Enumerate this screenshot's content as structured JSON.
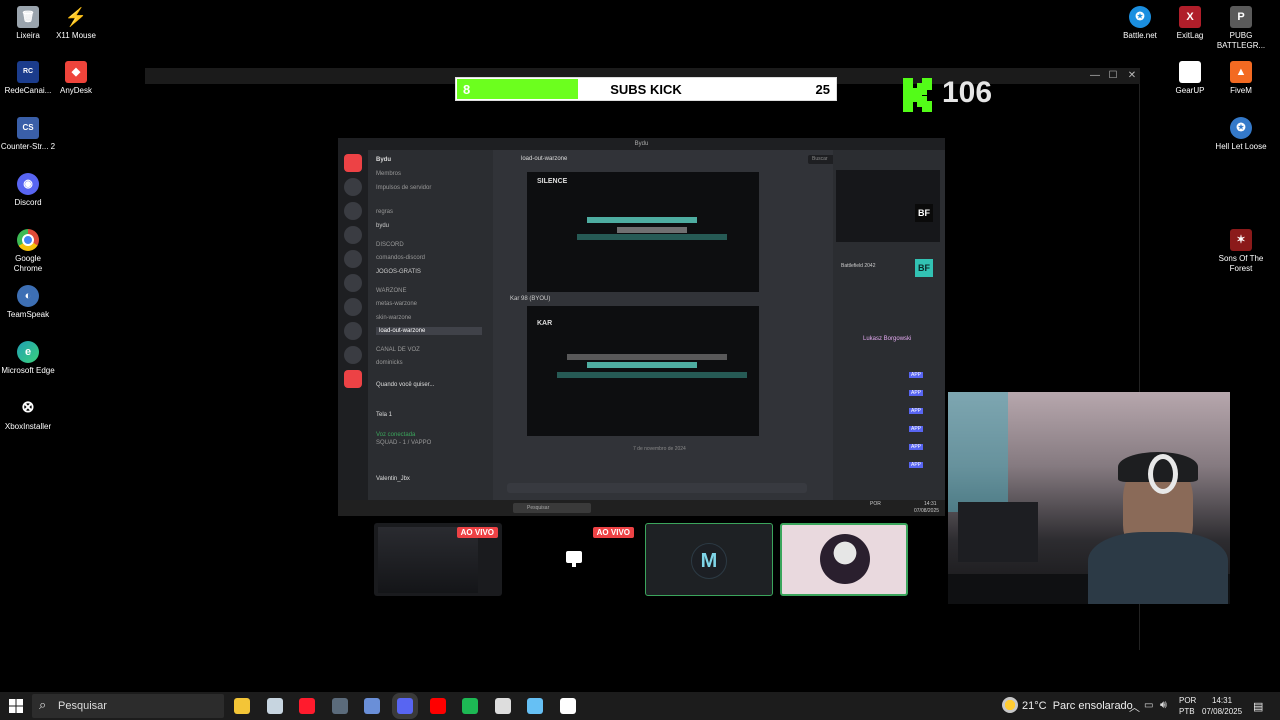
{
  "desktop_left": [
    {
      "label": "Lixeira",
      "icon": "recycle-bin-icon",
      "color": "#9aa4ad",
      "glyph": "🗑"
    },
    {
      "label": "X11 Mouse",
      "icon": "x11-mouse-icon",
      "color": "#f5c400",
      "glyph": "⚡"
    },
    {
      "label": "RedeCanai...",
      "icon": "redecanais-icon",
      "color": "#1b3c8c",
      "glyph": "R"
    },
    {
      "label": "AnyDesk",
      "icon": "anydesk-icon",
      "color": "#ef443b",
      "glyph": "◆"
    },
    {
      "label": "Counter-Str... 2",
      "icon": "counter-strike-icon",
      "color": "#3a5fa8",
      "glyph": "CS"
    },
    {
      "label": "Discord",
      "icon": "discord-icon",
      "color": "#5865f2",
      "glyph": "◉"
    },
    {
      "label": "Google Chrome",
      "icon": "chrome-icon",
      "color": "#dd4b39",
      "glyph": "◎"
    },
    {
      "label": "TeamSpeak",
      "icon": "teamspeak-icon",
      "color": "#3d6fb4",
      "glyph": "◐"
    },
    {
      "label": "Microsoft Edge",
      "icon": "edge-icon",
      "color": "#1fa0b5",
      "glyph": "e"
    },
    {
      "label": "XboxInstaller",
      "icon": "xbox-icon",
      "color": "#000000",
      "glyph": "⊗"
    }
  ],
  "desktop_right": [
    {
      "label": "Battle.net",
      "icon": "battlenet-icon",
      "color": "#1b8fe0",
      "glyph": "✪"
    },
    {
      "label": "ExitLag",
      "icon": "exitlag-icon",
      "color": "#b01e2a",
      "glyph": "X"
    },
    {
      "label": "PUBG BATTLEGR...",
      "icon": "pubg-icon",
      "color": "#5a5a5a",
      "glyph": "P"
    },
    {
      "label": "GearUP",
      "icon": "gearup-icon",
      "color": "#ffffff",
      "glyph": "▭"
    },
    {
      "label": "FiveM",
      "icon": "fivem-icon",
      "color": "#f36a22",
      "glyph": "▲"
    },
    {
      "label": "Hell Let Loose",
      "icon": "hell-let-loose-icon",
      "color": "#3479c9",
      "glyph": "✪"
    },
    {
      "label": "Sons Of The Forest",
      "icon": "sons-of-the-forest-icon",
      "color": "#8b1a1a",
      "glyph": "✶"
    }
  ],
  "subs_bar": {
    "current": "8",
    "title": "SUBS KICK",
    "goal": "25",
    "progress": 0.32,
    "fill_color": "#6cff1e"
  },
  "kick": {
    "count": "106",
    "brand_color": "#53fc18"
  },
  "discord": {
    "window_title": "Bydu",
    "server_name": "Bydu",
    "channel_header": "load-out-warzone",
    "search_placeholder": "Buscar",
    "channels": [
      "Membros",
      "Impulsos de servidor",
      "regras",
      "bydu",
      "DISCORD",
      "comandos-discord",
      "JOGOS-GRATIS",
      "WARZONE",
      "metas-warzone",
      "skin-warzone",
      "load-out-warzone",
      "CANAL DE VOZ",
      "dominicks"
    ],
    "msg_author": "Kar 98 (BYOU)",
    "img1_label": "SILENCE",
    "img2_label": "KAR",
    "date_divider": "7 de novembro de 2024",
    "bottom_user": "Valentin_Jbx",
    "voice_status": "Voz conectada",
    "voice_channel": "SQUAD - 1 / VAPPO",
    "stream_label": "Quando você quiser...",
    "tela": "Tela 1",
    "member_header": "Battlefield 2042",
    "member_name": "Lukasz Borgowski",
    "app_badge": "APP",
    "taskbar_search": "Pesquisar",
    "taskbar_lang": "POR",
    "taskbar_time": "14:31",
    "taskbar_date": "07/08/2025",
    "server_badges": [
      "BF",
      "BF"
    ]
  },
  "tiles": [
    {
      "name": "stream-tile-1",
      "live": "AO VIVO"
    },
    {
      "name": "stream-tile-2",
      "live": "AO VIVO"
    },
    {
      "name": "avatar-tile-m"
    },
    {
      "name": "avatar-tile-user"
    }
  ],
  "taskbar": {
    "search_placeholder": "Pesquisar",
    "weather": "21°C  Parc ensolarado",
    "lang_top": "POR",
    "lang_bottom": "PTB",
    "time": "14:31",
    "date": "07/08/2025",
    "apps": [
      {
        "icon": "file-explorer-icon",
        "color": "#f3c537"
      },
      {
        "icon": "steam-icon",
        "color": "#c7d5e0"
      },
      {
        "icon": "opera-icon",
        "color": "#ff1b2d"
      },
      {
        "icon": "calculator-icon",
        "color": "#5b6b7b"
      },
      {
        "icon": "app-blue-icon",
        "color": "#6a8fd8"
      },
      {
        "icon": "discord-taskbar-icon",
        "color": "#5865f2"
      },
      {
        "icon": "youtube-icon",
        "color": "#ff0000"
      },
      {
        "icon": "spotify-icon",
        "color": "#1db954"
      },
      {
        "icon": "obs-icon",
        "color": "#dddddd"
      },
      {
        "icon": "steam-alt-icon",
        "color": "#66c0f4"
      },
      {
        "icon": "notepad-icon",
        "color": "#ffffff"
      }
    ]
  }
}
